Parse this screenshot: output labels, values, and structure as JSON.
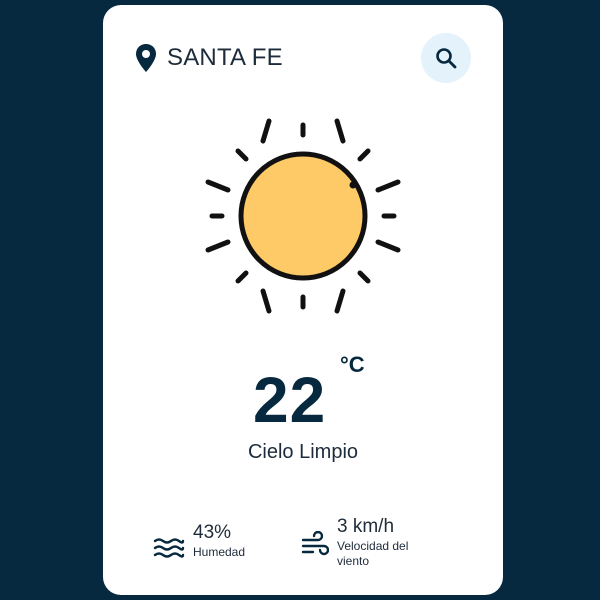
{
  "location": {
    "icon": "map-pin-icon",
    "city": "SANTA FE"
  },
  "search": {
    "icon": "search-icon",
    "background": "#e3f2fb"
  },
  "weather": {
    "icon": "sun-icon",
    "temperature": "22",
    "unit": "°C",
    "condition": "Cielo Limpio"
  },
  "stats": {
    "humidity": {
      "icon": "waves-icon",
      "value": "43%",
      "label": "Humedad"
    },
    "wind": {
      "icon": "wind-icon",
      "value": "3 km/h",
      "label": "Velocidad del viento"
    }
  },
  "colors": {
    "background": "#06293f",
    "card": "#ffffff",
    "sun_fill": "#fdca67",
    "text_dark": "#06293f"
  }
}
